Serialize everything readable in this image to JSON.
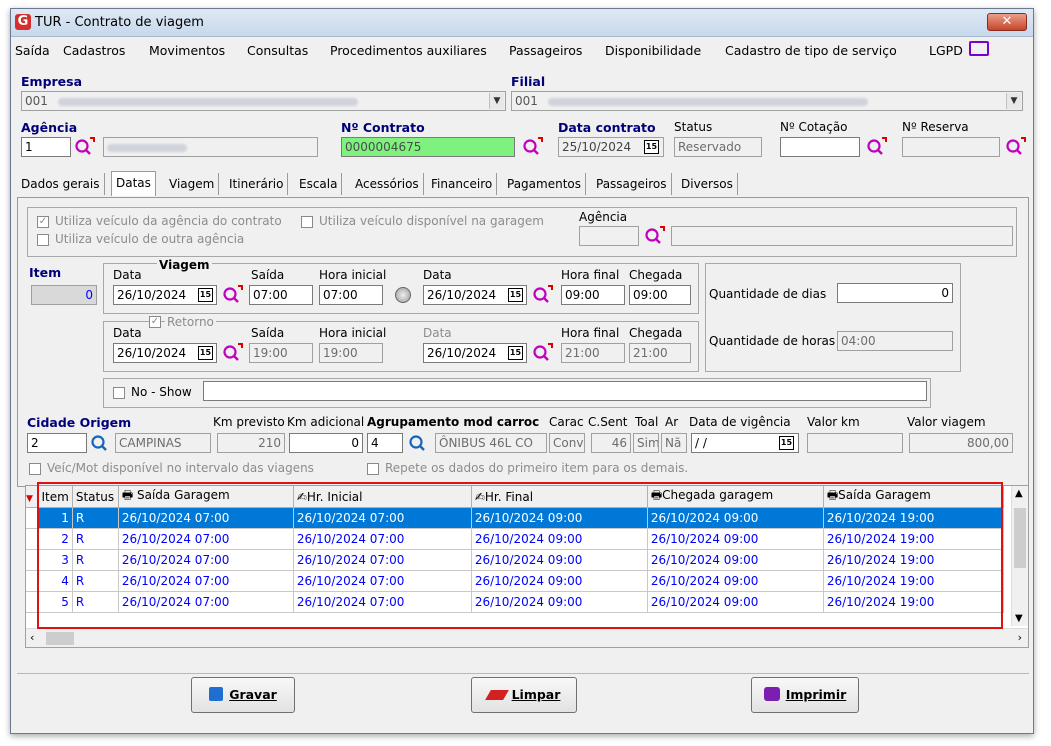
{
  "window": {
    "title": "TUR - Contrato de viagem",
    "close_label": "✕"
  },
  "menu": [
    "Saída",
    "Cadastros",
    "Movimentos",
    "Consultas",
    "Procedimentos auxiliares",
    "Passageiros",
    "Disponibilidade",
    "Cadastro de tipo de serviço",
    "LGPD"
  ],
  "empresa": {
    "label": "Empresa",
    "code": "001"
  },
  "filial": {
    "label": "Filial",
    "code": "001"
  },
  "agencia": {
    "label": "Agência",
    "code": "1"
  },
  "contrato": {
    "label": "Nº Contrato",
    "value": "0000004675"
  },
  "data_contrato": {
    "label": "Data contrato",
    "value": "25/10/2024"
  },
  "status": {
    "label": "Status",
    "value": "Reservado"
  },
  "cotacao": {
    "label": "Nº Cotação",
    "value": ""
  },
  "reserva": {
    "label": "Nº Reserva",
    "value": ""
  },
  "tabs": [
    "Dados gerais",
    "Datas",
    "Viagem",
    "Itinerário",
    "Escala",
    "Acessórios",
    "Financeiro",
    "Pagamentos",
    "Passageiros",
    "Diversos"
  ],
  "datas": {
    "cb_agencia_contrato": "Utiliza veículo da agência do contrato",
    "cb_garagem": "Utiliza veículo disponível na garagem",
    "cb_outra_agencia": "Utiliza veículo de outra agência",
    "agencia_label": "Agência",
    "item_label": "Item",
    "item_value": "0",
    "viagem_label": "Viagem",
    "retorno_label": "Retorno",
    "data_label": "Data",
    "saida_label": "Saída",
    "hora_inicial_label": "Hora inicial",
    "hora_final_label": "Hora final",
    "chegada_label": "Chegada",
    "ida": {
      "data": "26/10/2024",
      "saida": "07:00",
      "hora_inicial": "07:00",
      "data2": "26/10/2024",
      "hora_final": "09:00",
      "chegada": "09:00"
    },
    "volta": {
      "data": "26/10/2024",
      "saida": "19:00",
      "hora_inicial": "19:00",
      "data2": "26/10/2024",
      "hora_final": "21:00",
      "chegada": "21:00"
    },
    "qtd_dias_label": "Quantidade de dias",
    "qtd_dias": "0",
    "qtd_horas_label": "Quantidade de horas",
    "qtd_horas": "04:00",
    "noshow_label": "No - Show",
    "cidade_origem_label": "Cidade Origem",
    "cidade_code": "2",
    "cidade_nome": "CAMPINAS",
    "km_previsto_label": "Km previsto",
    "km_previsto": "210",
    "km_adicional_label": "Km adicional",
    "km_adicional": "0",
    "agrupamento_label": "Agrupamento mod carroc",
    "agrupamento_code": "4",
    "agrupamento_nome": "ÔNIBUS 46L CO",
    "carac_label": "Carac",
    "carac": "Conv",
    "csent_label": "C.Sent",
    "csent": "46",
    "toal_label": "Toal",
    "toal": "Sim",
    "ar_label": "Ar",
    "ar": "Nã",
    "vigencia_label": "Data de vigência",
    "vigencia": " / /",
    "valor_km_label": "Valor km",
    "valor_km": "",
    "valor_viagem_label": "Valor viagem",
    "valor_viagem": "800,00",
    "cb_veic_mot": "Veíc/Mot disponível no intervalo das viagens",
    "cb_repete": "Repete os dados do primeiro item para os demais."
  },
  "grid": {
    "columns": [
      "Item",
      "Status",
      "Saída Garagem",
      "Hr. Inicial",
      "Hr. Final",
      "Chegada garagem",
      "Saída Garagem"
    ],
    "rows": [
      [
        "1",
        "R",
        "26/10/2024 07:00",
        "26/10/2024 07:00",
        "26/10/2024 09:00",
        "26/10/2024 09:00",
        "26/10/2024 19:00"
      ],
      [
        "2",
        "R",
        "26/10/2024 07:00",
        "26/10/2024 07:00",
        "26/10/2024 09:00",
        "26/10/2024 09:00",
        "26/10/2024 19:00"
      ],
      [
        "3",
        "R",
        "26/10/2024 07:00",
        "26/10/2024 07:00",
        "26/10/2024 09:00",
        "26/10/2024 09:00",
        "26/10/2024 19:00"
      ],
      [
        "4",
        "R",
        "26/10/2024 07:00",
        "26/10/2024 07:00",
        "26/10/2024 09:00",
        "26/10/2024 09:00",
        "26/10/2024 19:00"
      ],
      [
        "5",
        "R",
        "26/10/2024 07:00",
        "26/10/2024 07:00",
        "26/10/2024 09:00",
        "26/10/2024 09:00",
        "26/10/2024 19:00"
      ]
    ]
  },
  "buttons": {
    "gravar": "Gravar",
    "limpar": "Limpar",
    "imprimir": "Imprimir"
  },
  "colors": {
    "selected_row": "#0078d7",
    "row_text": "#0000ff",
    "label_navy": "#00007a",
    "contract_green": "#7ff17f",
    "highlight_red": "#dd1111"
  }
}
